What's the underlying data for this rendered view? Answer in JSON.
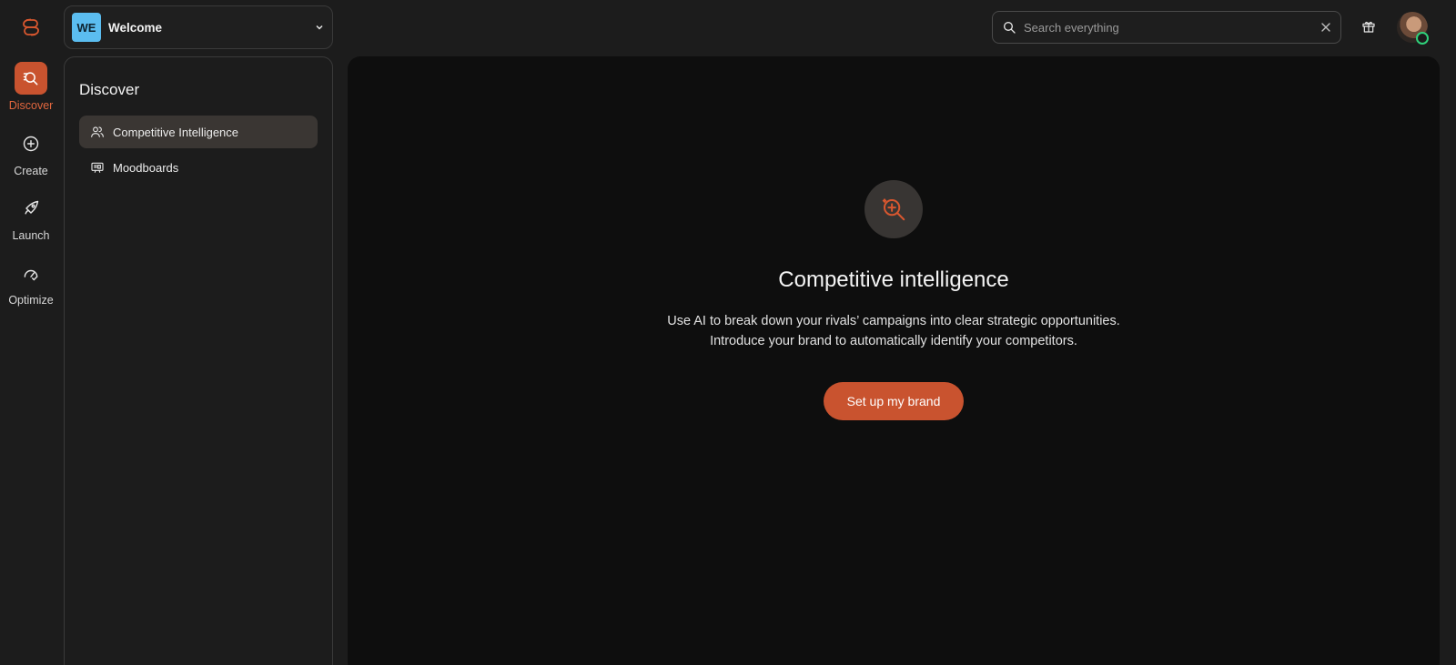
{
  "colors": {
    "accent": "#c9532f",
    "workspace_badge": "#5bbdf0",
    "main_bg": "#0e0e0e",
    "app_bg": "#1c1c1c"
  },
  "rail": {
    "logo": "brand-logo-icon",
    "items": [
      {
        "label": "Discover",
        "icon": "discover-search-icon",
        "active": true
      },
      {
        "label": "Create",
        "icon": "plus-circle-icon",
        "active": false
      },
      {
        "label": "Launch",
        "icon": "rocket-icon",
        "active": false
      },
      {
        "label": "Optimize",
        "icon": "gauge-icon",
        "active": false
      }
    ]
  },
  "workspace": {
    "initials": "WE",
    "name": "Welcome"
  },
  "panel": {
    "title": "Discover",
    "items": [
      {
        "label": "Competitive Intelligence",
        "icon": "users-icon",
        "active": true
      },
      {
        "label": "Moodboards",
        "icon": "moodboard-icon",
        "active": false
      }
    ]
  },
  "search": {
    "placeholder": "Search everything",
    "value": ""
  },
  "main": {
    "title": "Competitive intelligence",
    "description_line1": "Use AI to break down your rivals’ campaigns into clear strategic opportunities.",
    "description_line2": "Introduce your brand to automatically identify your competitors.",
    "cta_label": "Set up my brand"
  }
}
